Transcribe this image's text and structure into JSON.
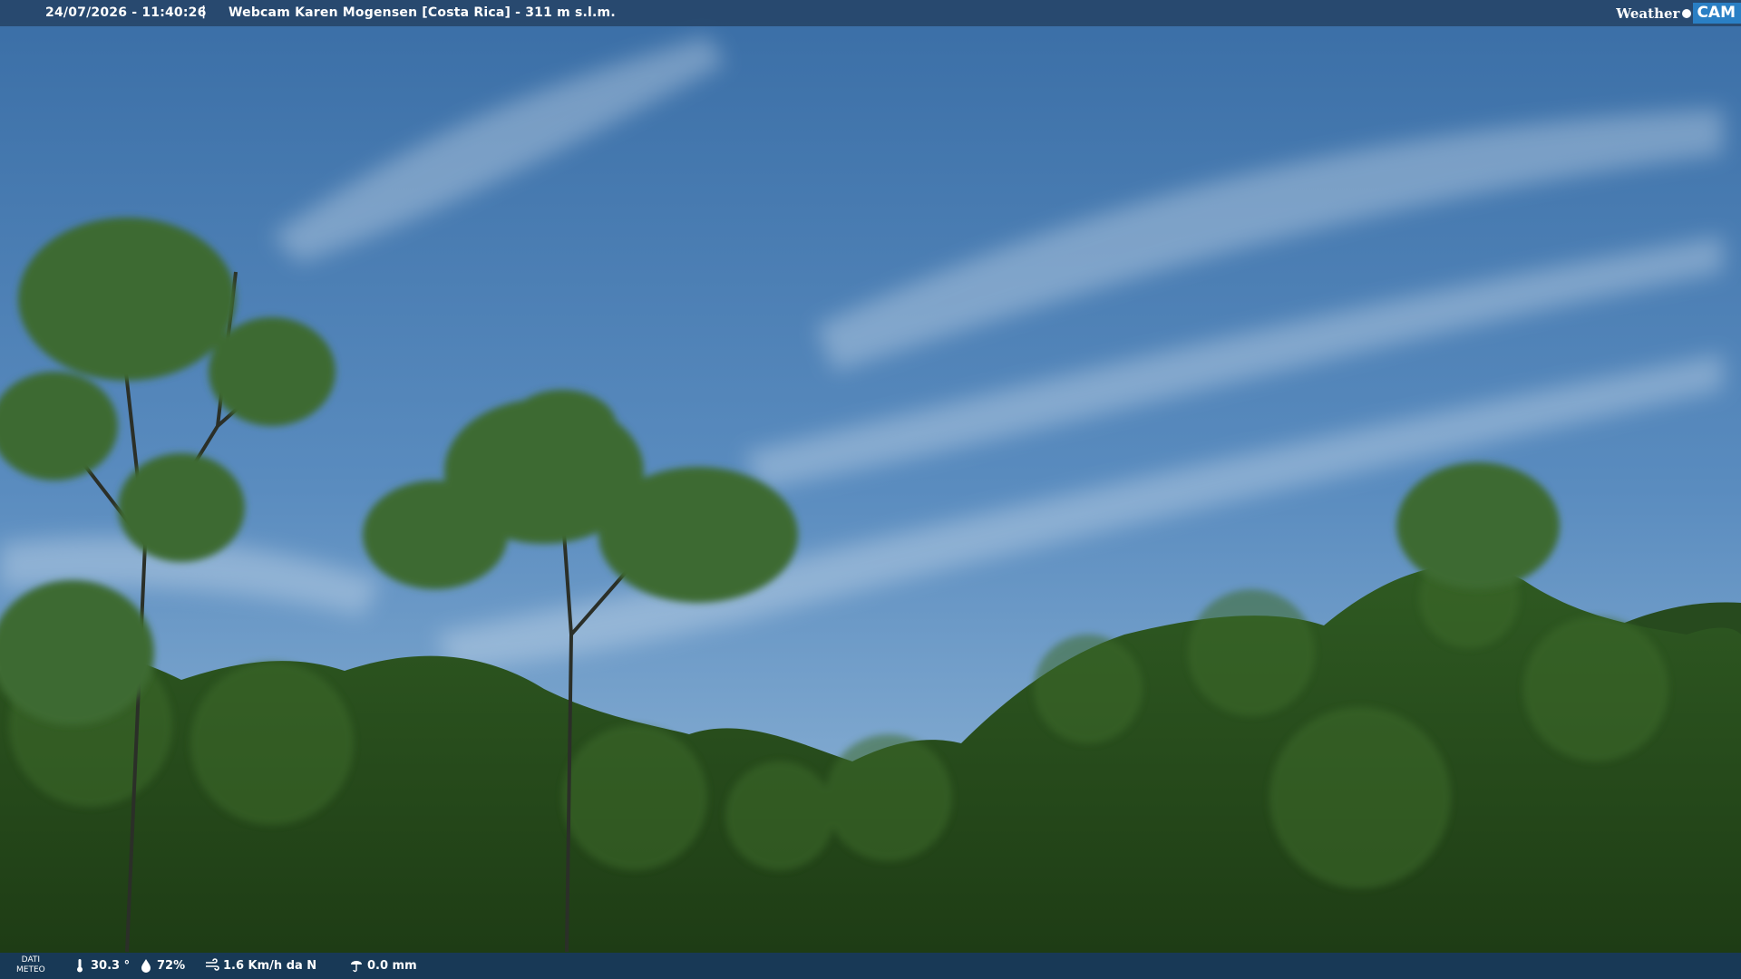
{
  "overlay": {
    "timestamp": "24/07/2026 - 11:40:26",
    "separator": "|",
    "title": "Webcam Karen Mogensen [Costa Rica]  - 311 m s.l.m."
  },
  "logo": {
    "word": "Weather",
    "cam": "CAM"
  },
  "weather_bar": {
    "label_line1": "DATI",
    "label_line2": "METEO",
    "temperature": "30.3 °",
    "humidity": "72%",
    "wind": "1.6 Km/h da N",
    "rain": "0.0 mm"
  },
  "icons": {
    "temperature": "thermometer-icon",
    "humidity": "humidity-drop-icon",
    "wind": "wind-icon",
    "rain": "rain-gauge-icon"
  }
}
